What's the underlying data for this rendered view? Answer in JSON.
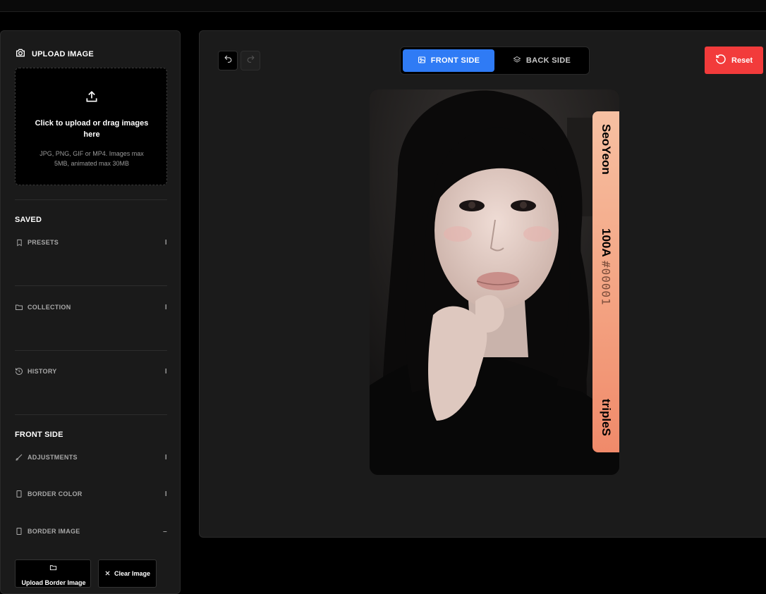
{
  "sidebar": {
    "upload": {
      "title": "UPLOAD IMAGE",
      "main_text": "Click to upload or drag images here",
      "sub_text": "JPG, PNG, GIF or MP4. Images max 5MB, animated max 30MB"
    },
    "saved": {
      "title": "SAVED",
      "items": [
        {
          "label": "PRESETS",
          "toggle": "I"
        },
        {
          "label": "COLLECTION",
          "toggle": "I"
        },
        {
          "label": "HISTORY",
          "toggle": "I"
        }
      ]
    },
    "front_side": {
      "title": "FRONT SIDE",
      "items": [
        {
          "label": "ADJUSTMENTS",
          "toggle": "I"
        },
        {
          "label": "BORDER COLOR",
          "toggle": "I"
        },
        {
          "label": "BORDER IMAGE",
          "toggle": "–"
        }
      ],
      "upload_border_label": "Upload Border Image",
      "clear_image_label": "Clear Image"
    }
  },
  "toolbar": {
    "tabs": [
      {
        "label": "FRONT SIDE",
        "active": true
      },
      {
        "label": "BACK SIDE",
        "active": false
      }
    ],
    "reset_label": "Reset"
  },
  "card": {
    "member_name": "SeoYeon",
    "serial_code": "100A",
    "serial_number": "#00001",
    "group_name": "tripleS",
    "band_colors": [
      "#f6c0a2",
      "#f4a685",
      "#f08a6a"
    ]
  },
  "colors": {
    "accent": "#2f7bf5",
    "danger": "#f23b3b"
  }
}
